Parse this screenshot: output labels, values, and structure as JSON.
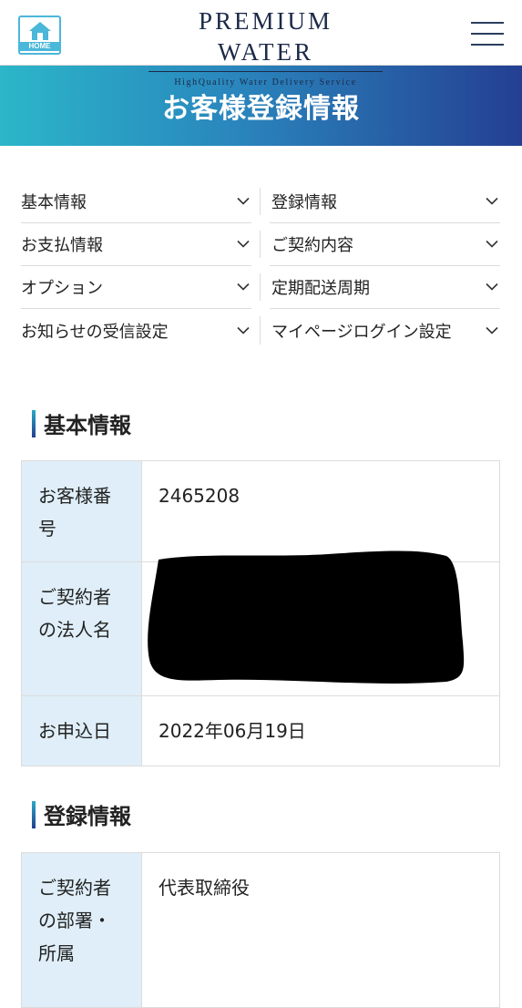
{
  "header": {
    "home_label": "HOME",
    "brand_title": "PREMIUM WATER",
    "brand_subtitle": "HighQuality Water Delivery Service"
  },
  "banner": {
    "title": "お客様登録情報"
  },
  "anchor_nav": [
    {
      "label": "基本情報"
    },
    {
      "label": "登録情報"
    },
    {
      "label": "お支払情報"
    },
    {
      "label": "ご契約内容"
    },
    {
      "label": "オプション"
    },
    {
      "label": "定期配送周期"
    },
    {
      "label": "お知らせの受信設定"
    },
    {
      "label": "マイページログイン設定"
    }
  ],
  "basic_info": {
    "title": "基本情報",
    "rows": [
      {
        "label": "お客様番号",
        "value": "2465208"
      },
      {
        "label": "ご契約者の法人名",
        "value": ""
      },
      {
        "label": "お申込日",
        "value": "2022年06月19日"
      }
    ]
  },
  "registration_info": {
    "title": "登録情報",
    "rows": [
      {
        "label": "ご契約者の部署・所属",
        "value": "代表取締役"
      }
    ]
  },
  "colors": {
    "accent": "#4bb7d9",
    "brand_navy": "#1c2a48",
    "banner_start": "#2bb6c9",
    "banner_end": "#243f92",
    "table_header_bg": "#dfeef8"
  }
}
